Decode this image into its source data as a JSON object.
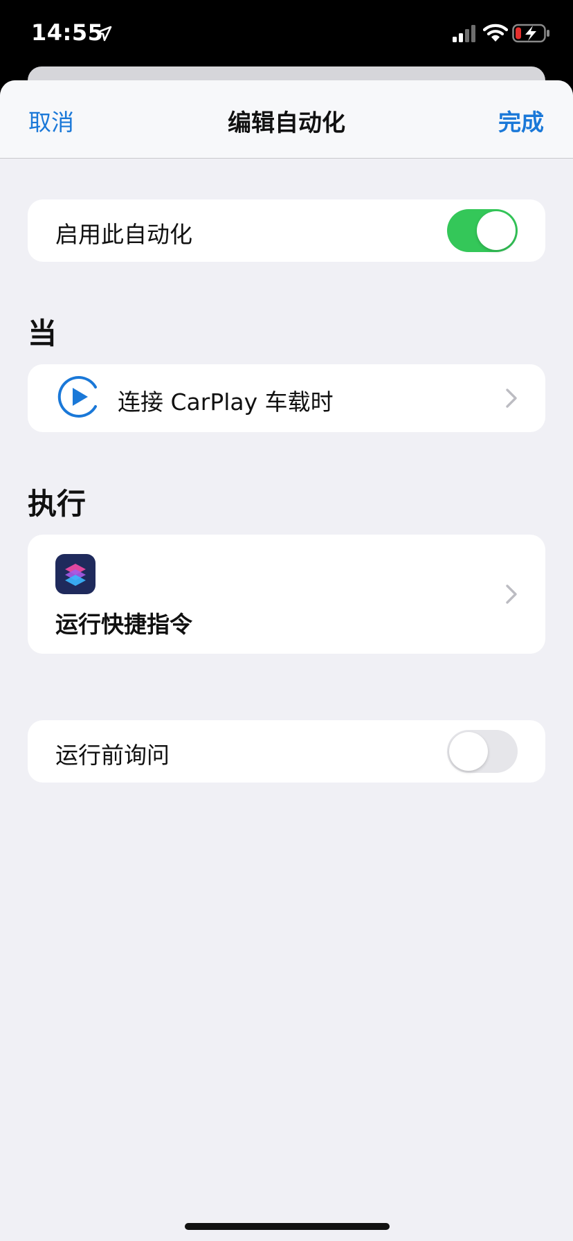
{
  "status_bar": {
    "time": "14:55",
    "colors": {
      "battery_low": "#e5302e"
    }
  },
  "nav": {
    "cancel_label": "取消",
    "title": "编辑自动化",
    "done_label": "完成"
  },
  "enable_row": {
    "label": "启用此自动化",
    "toggle_on": true
  },
  "when_section": {
    "header": "当",
    "trigger_label": "连接 CarPlay 车载时",
    "icon": "carplay-icon"
  },
  "do_section": {
    "header": "执行",
    "action_label": "运行快捷指令",
    "icon": "shortcuts-app-icon"
  },
  "ask_row": {
    "label": "运行前询问",
    "toggle_on": false
  },
  "colors": {
    "accent": "#1a78d8",
    "toggle_on": "#34c759",
    "background": "#f0f0f5"
  }
}
